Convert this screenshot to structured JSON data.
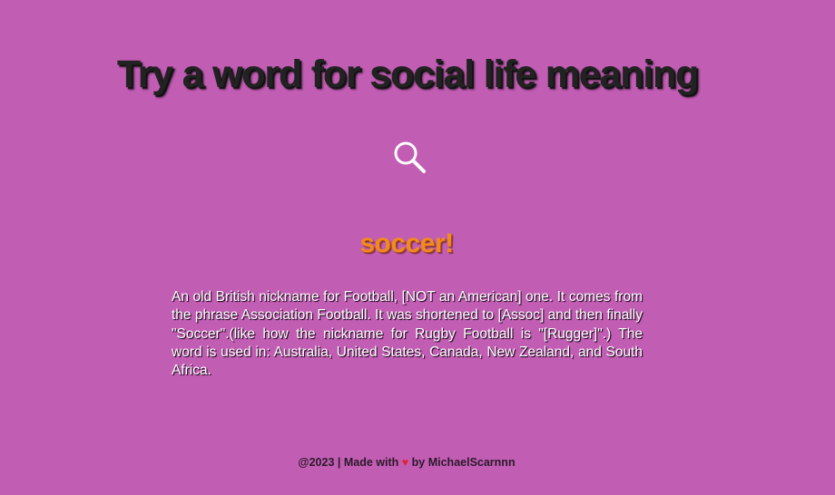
{
  "header": {
    "title": "Try a word for social life meaning"
  },
  "search": {
    "icon": "search-icon",
    "icon_color": "#ffffff"
  },
  "result": {
    "word": "soccer!",
    "meaning": "An old British nickname for Football, [NOT an American] one. It comes from the phrase Association Football. It was shortened to [Assoc] and then finally \"Soccer\".(like how the nickname for Rugby Football is \"[Rugger]\".) The word is used in: Australia, United States, Canada, New Zealand, and South Africa."
  },
  "footer": {
    "prefix": "@2023 | Made with",
    "heart": "♥",
    "suffix": "by MichaelScarnnn"
  },
  "colors": {
    "background": "#c25db4",
    "word_accent": "#f18b1c",
    "heart": "#e0233a"
  }
}
